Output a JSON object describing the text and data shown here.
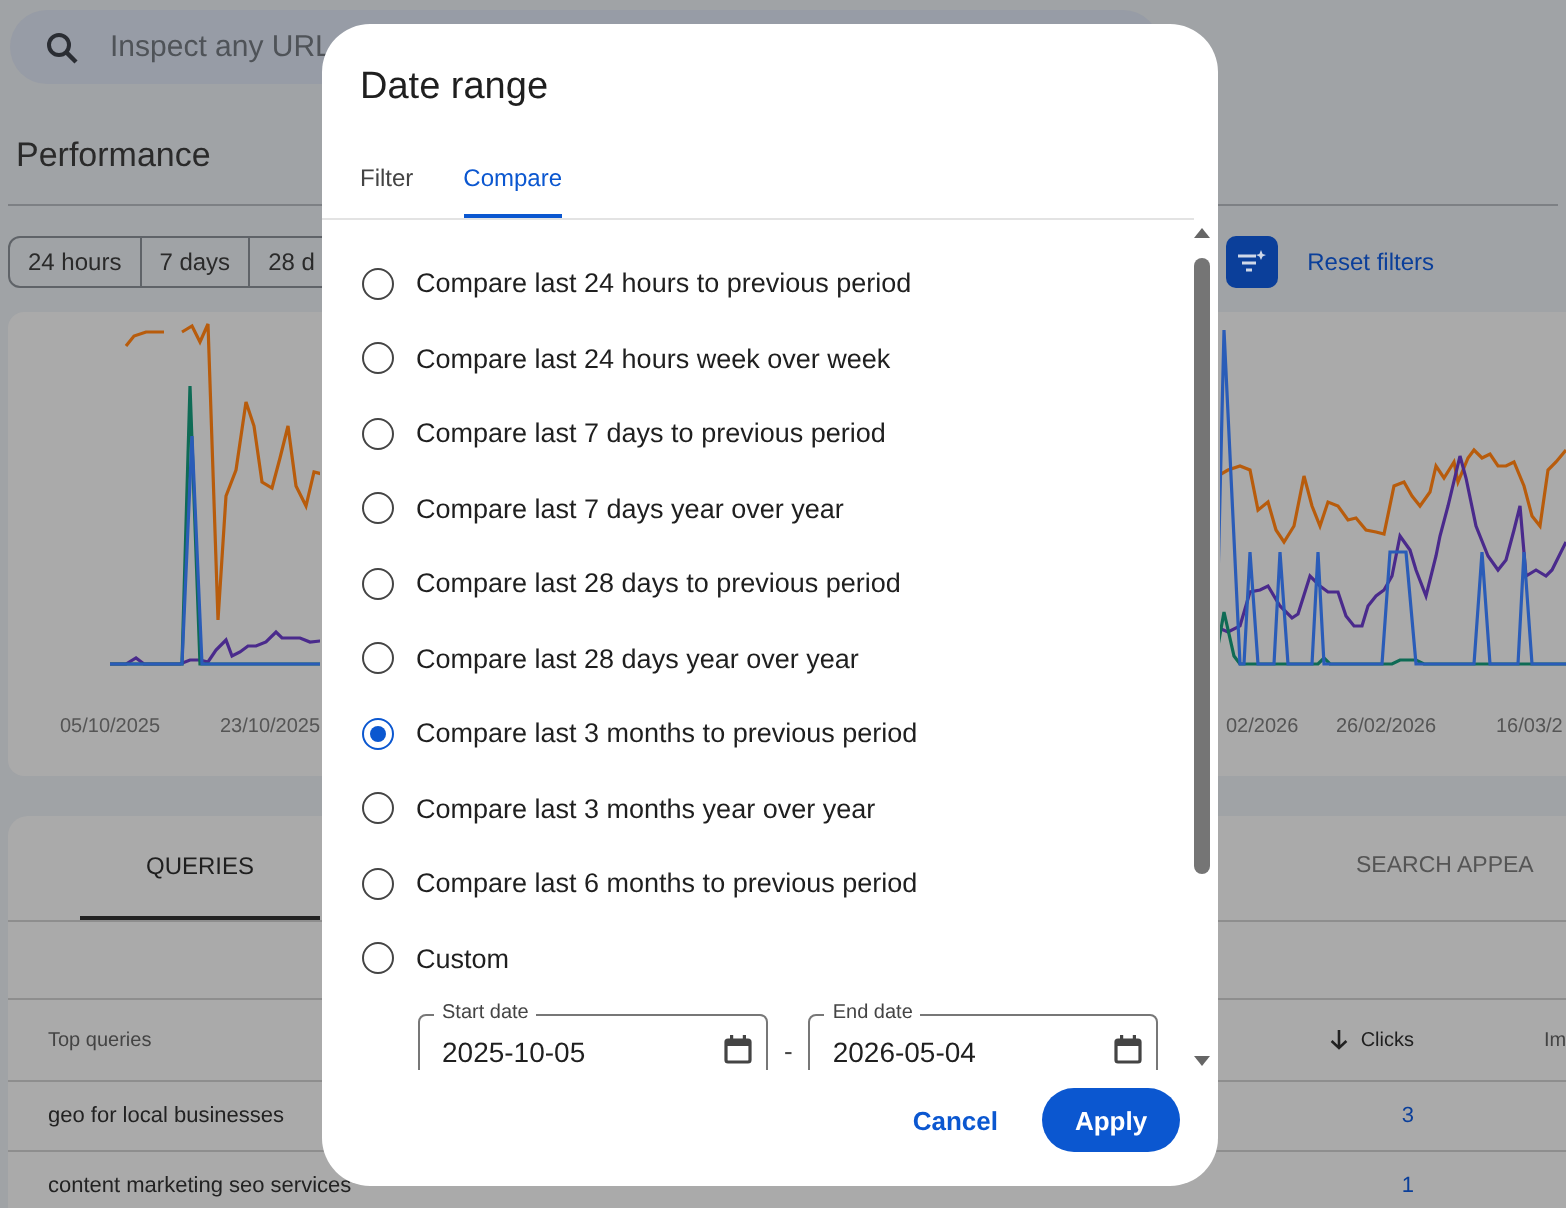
{
  "search": {
    "placeholder": "Inspect any URL"
  },
  "page_title": "Performance",
  "date_chips": [
    {
      "label": "24 hours",
      "selected": false
    },
    {
      "label": "7 days",
      "selected": false
    },
    {
      "label": "28 d",
      "selected": false
    }
  ],
  "reset_filters": "Reset filters",
  "chart": {
    "x_labels": [
      "05/10/2025",
      "23/10/2025",
      "02/2026",
      "26/02/2026",
      "16/03/2"
    ]
  },
  "table": {
    "tabs": [
      {
        "label": "QUERIES",
        "selected": true
      },
      {
        "label": "SEARCH APPEA",
        "selected": false
      }
    ],
    "columns": [
      {
        "label": "Top queries",
        "sorted": false
      },
      {
        "label": "Clicks",
        "sorted": true
      },
      {
        "label": "Im",
        "sorted": false
      }
    ],
    "rows": [
      {
        "query": "geo for local businesses",
        "clicks": "3"
      },
      {
        "query": "content marketing seo services",
        "clicks": "1"
      }
    ]
  },
  "dialog": {
    "title": "Date range",
    "tabs": [
      {
        "label": "Filter",
        "selected": false
      },
      {
        "label": "Compare",
        "selected": true
      }
    ],
    "options": [
      {
        "label": "Compare last 24 hours to previous period",
        "selected": false
      },
      {
        "label": "Compare last 24 hours week over week",
        "selected": false
      },
      {
        "label": "Compare last 7 days to previous period",
        "selected": false
      },
      {
        "label": "Compare last 7 days year over year",
        "selected": false
      },
      {
        "label": "Compare last 28 days to previous period",
        "selected": false
      },
      {
        "label": "Compare last 28 days year over year",
        "selected": false
      },
      {
        "label": "Compare last 3 months to previous period",
        "selected": true
      },
      {
        "label": "Compare last 3 months year over year",
        "selected": false
      },
      {
        "label": "Compare last 6 months to previous period",
        "selected": false
      },
      {
        "label": "Custom",
        "selected": false
      }
    ],
    "custom_range": {
      "start": {
        "label": "Start date",
        "value": "2025-10-05"
      },
      "separator": "-",
      "end": {
        "label": "End date",
        "value": "2026-05-04"
      }
    },
    "cancel": "Cancel",
    "apply": "Apply"
  }
}
